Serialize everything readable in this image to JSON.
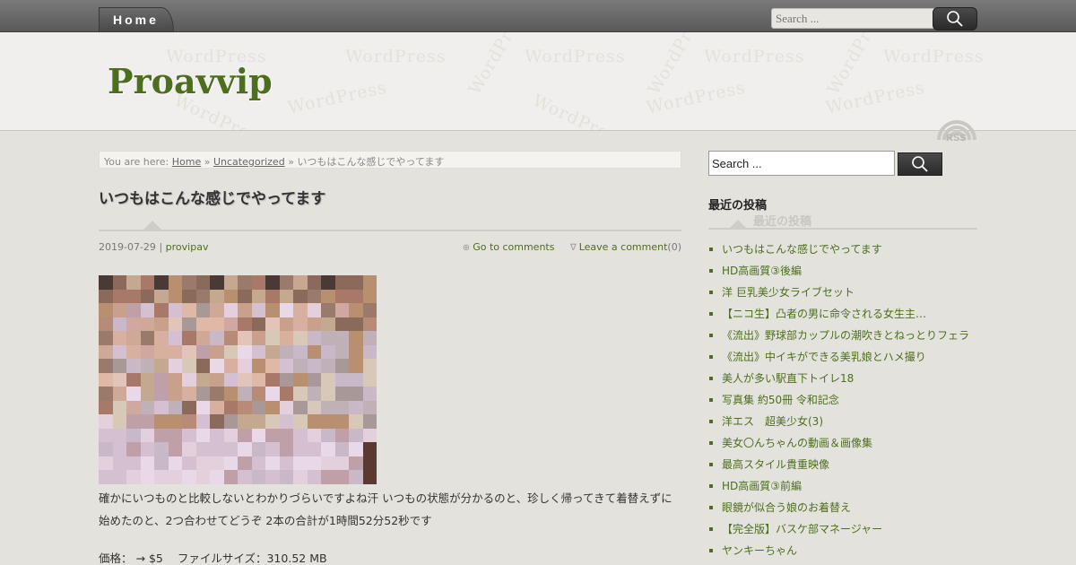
{
  "nav": {
    "home_label": "Home"
  },
  "top_search": {
    "placeholder": "Search ..."
  },
  "site": {
    "title": "Proavvip",
    "watermark": "WordPress",
    "rss_label": "RSS"
  },
  "breadcrumb": {
    "prefix": "You are here:",
    "home": "Home",
    "sep": "»",
    "category": "Uncategorized",
    "current": "いつもはこんな感じでやってます"
  },
  "post": {
    "title": "いつもはこんな感じでやってます",
    "date": "2019-07-29",
    "meta_sep": "|",
    "author": "provipav",
    "go_to_comments": "Go to comments",
    "leave_comment": "Leave a comment",
    "comment_count": "(0)",
    "body": "確かにいつものと比較しないとわかりづらいですよね汗 いつもの状態が分かるのと、珍しく帰ってきて着替えずに始めたのと、2つ合わせてどうぞ 2本の合計が1時間52分52秒です",
    "price_label": "価格：",
    "price_value": "→ $5",
    "filesize_label": "ファイルサイズ：",
    "filesize_value": "310.52 MB"
  },
  "sidebar": {
    "search_value": "Search ...",
    "widget_title": "最近の投稿",
    "recent_posts": [
      "いつもはこんな感じでやってます",
      "HD高画質③後編",
      "洋 巨乳美少女ライブセット",
      "【ニコ生】凸者の男に命令される女生主…",
      "《流出》野球部カップルの潮吹きとねっとりフェラ",
      "《流出》中イキができる美乳娘とハメ撮り",
      "美人が多い駅直下トイレ18",
      "写真集 約50冊 令和記念",
      "洋エス　超美少女(3)",
      "美女〇んちゃんの動画＆画像集",
      "最高スタイル貴重映像",
      "HD高画質③前編",
      "眼鏡が似合う娘のお着替え",
      "【完全版】バスケ部マネージャー",
      "ヤンキーちゃん"
    ]
  },
  "colors": {
    "accent": "#4d6e1e",
    "bar": "#5a5a5a",
    "bg": "#e4e2dd"
  },
  "icons": {
    "search": "search-icon",
    "rss": "rss-icon"
  }
}
